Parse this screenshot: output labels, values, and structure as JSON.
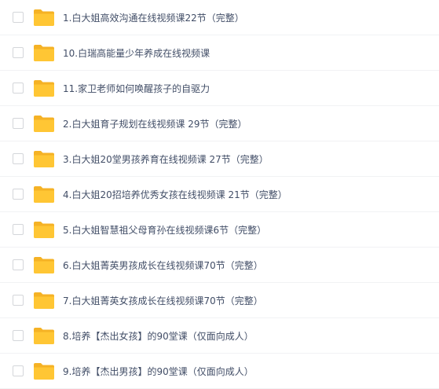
{
  "colors": {
    "folder": "#ffc634",
    "folder_tab": "#f5b225",
    "text": "#424e67",
    "divider": "#f1f2f4"
  },
  "files": [
    {
      "name": "1.白大姐高效沟通在线视频课22节（完整）",
      "icon": "folder-icon"
    },
    {
      "name": "10.白瑞高能量少年养成在线视频课",
      "icon": "folder-icon"
    },
    {
      "name": "11.家卫老师如何唤醒孩子的自驱力",
      "icon": "folder-icon"
    },
    {
      "name": "2.白大姐育子规划在线视频课 29节（完整）",
      "icon": "folder-icon"
    },
    {
      "name": "3.白大姐20堂男孩养育在线视频课 27节（完整）",
      "icon": "folder-icon"
    },
    {
      "name": "4.白大姐20招培养优秀女孩在线视频课 21节（完整）",
      "icon": "folder-icon"
    },
    {
      "name": "5.白大姐智慧祖父母育孙在线视频课6节（完整）",
      "icon": "folder-icon"
    },
    {
      "name": "6.白大姐菁英男孩成长在线视频课70节（完整）",
      "icon": "folder-icon"
    },
    {
      "name": "7.白大姐菁英女孩成长在线视频课70节（完整）",
      "icon": "folder-icon"
    },
    {
      "name": "8.培养【杰出女孩】的90堂课（仅面向成人）",
      "icon": "folder-icon"
    },
    {
      "name": "9.培养【杰出男孩】的90堂课（仅面向成人）",
      "icon": "folder-icon"
    }
  ]
}
